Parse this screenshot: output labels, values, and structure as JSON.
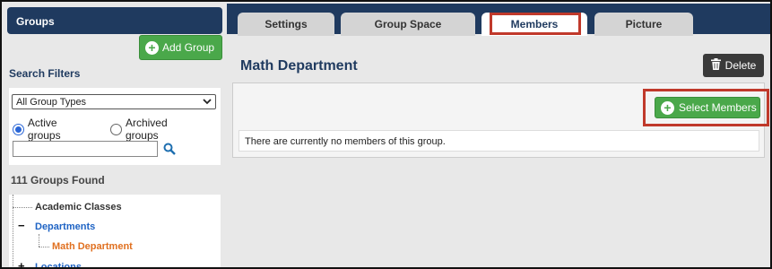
{
  "sidebar": {
    "header": "Groups",
    "add_group_label": "Add Group",
    "search_filters_title": "Search Filters",
    "group_type_selected": "All Group Types",
    "radio_active_label": "Active groups",
    "radio_archived_label": "Archived groups",
    "radio_selected": "Active groups",
    "search_value": "",
    "found_text": "111 Groups Found",
    "tree": {
      "academic_classes": "Academic Classes",
      "departments": "Departments",
      "math_department": "Math Department",
      "locations": "Locations",
      "departments_toggle": "−",
      "locations_toggle": "+"
    }
  },
  "tabs": [
    {
      "label": "Settings"
    },
    {
      "label": "Group Space"
    },
    {
      "label": "Members"
    },
    {
      "label": "Picture"
    }
  ],
  "active_tab": "Members",
  "main": {
    "title": "Math Department",
    "delete_label": "Delete",
    "select_members_label": "Select Members",
    "empty_message": "There are currently no members of this group."
  },
  "colors": {
    "header_navy": "#1f3a5f",
    "green_button": "#4aa84a",
    "highlight_red": "#c0392b",
    "tree_link_blue": "#1e63c4",
    "tree_active_orange": "#e07020"
  },
  "icons": [
    "plus-circle-icon",
    "chevron-down-icon",
    "search-icon",
    "trash-icon"
  ]
}
